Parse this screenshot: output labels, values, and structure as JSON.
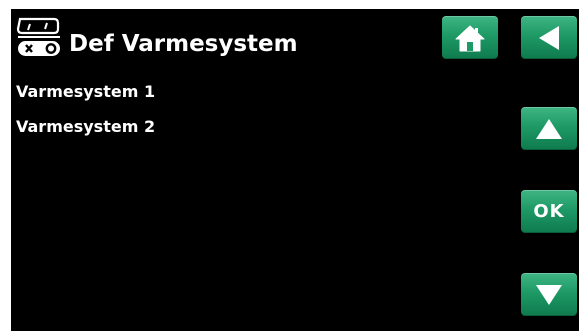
{
  "header": {
    "title": "Def Varmesystem",
    "icon": "heating-system-icon"
  },
  "menu": {
    "items": [
      {
        "label": "Varmesystem 1"
      },
      {
        "label": "Varmesystem 2"
      }
    ]
  },
  "buttons": {
    "home_icon": "home-icon",
    "back_icon": "back-arrow-icon",
    "up_icon": "up-arrow-icon",
    "ok_label": "OK",
    "down_icon": "down-arrow-icon"
  },
  "colors": {
    "background": "#000000",
    "text": "#ffffff",
    "button_green": "#1e9a66"
  }
}
